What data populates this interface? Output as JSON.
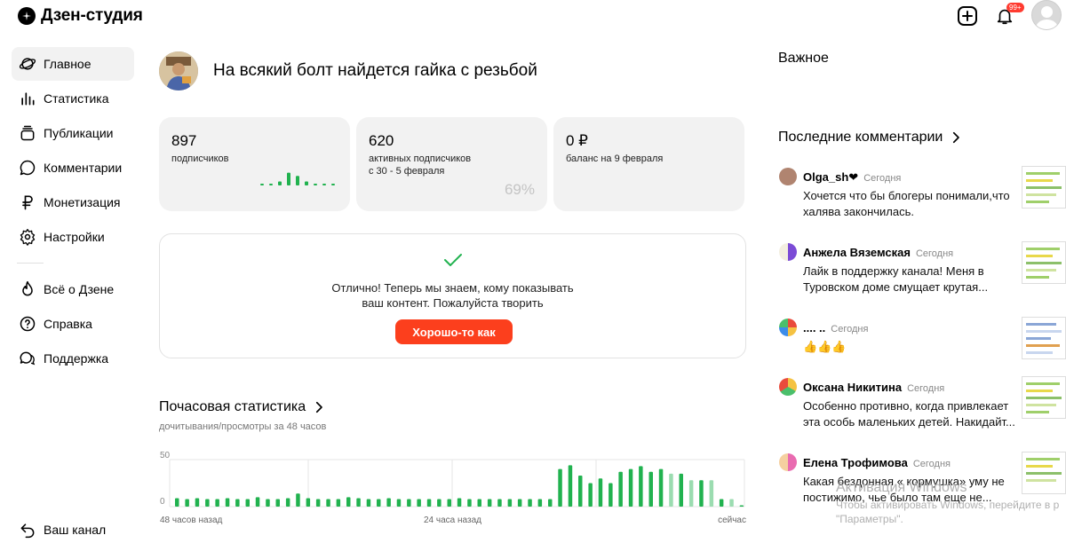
{
  "header": {
    "logo_text": "Дзен-студия",
    "notification_badge": "99+"
  },
  "sidebar": {
    "items": [
      {
        "label": "Главное",
        "icon": "planet-icon",
        "active": true
      },
      {
        "label": "Статистика",
        "icon": "bar-chart-icon"
      },
      {
        "label": "Публикации",
        "icon": "stack-icon"
      },
      {
        "label": "Комментарии",
        "icon": "comment-icon"
      },
      {
        "label": "Монетизация",
        "icon": "ruble-icon"
      },
      {
        "label": "Настройки",
        "icon": "gear-icon"
      }
    ],
    "secondary": [
      {
        "label": "Всё о Дзене",
        "icon": "flame-icon"
      },
      {
        "label": "Справка",
        "icon": "help-icon"
      },
      {
        "label": "Поддержка",
        "icon": "support-icon"
      }
    ],
    "your_channel": "Ваш канал"
  },
  "channel": {
    "title": "На всякий болт найдется гайка с резьбой"
  },
  "stats": {
    "subscribers": {
      "value": "897",
      "label": "подписчиков",
      "mini_bars": [
        0.1,
        0.1,
        0.25,
        0.8,
        0.6,
        0.25,
        0.1,
        0.1,
        0.1
      ]
    },
    "active": {
      "value": "620",
      "label": "активных подписчиков",
      "period": "с 30 - 5 февраля",
      "percent": "69%"
    },
    "balance": {
      "value": "0 ₽",
      "label": "баланс на 9 февраля"
    }
  },
  "success": {
    "line1": "Отлично! Теперь мы знаем, кому показывать",
    "line2": "ваш контент. Пожалуйста творить",
    "button": "Хорошо-то как"
  },
  "hourly": {
    "title": "Почасовая статистика",
    "subtitle": "дочитывания/просмотры за 48 часов",
    "y_max_label": "50",
    "y_min_label": "0",
    "x_labels": [
      "48 часов назад",
      "24 часа назад",
      "сейчас"
    ]
  },
  "chart_data": {
    "type": "bar",
    "title": "Почасовая статистика",
    "subtitle": "дочитывания/просмотры за 48 часов",
    "ylim": [
      0,
      50
    ],
    "x_tick_labels": [
      "48 часов назад",
      "24 часа назад",
      "сейчас"
    ],
    "series": [
      {
        "values": [
          9,
          8,
          9,
          8,
          8,
          9,
          8,
          8,
          10,
          8,
          8,
          9,
          14,
          9,
          8,
          8,
          8,
          10,
          9,
          8,
          8,
          9,
          8,
          8,
          8,
          8,
          8,
          8,
          9,
          8,
          8,
          8,
          8,
          8,
          8,
          8,
          8,
          8,
          40,
          44,
          33,
          25,
          30,
          25,
          37,
          40,
          43,
          37,
          40,
          35,
          35,
          28,
          28,
          28,
          8,
          8,
          1
        ]
      }
    ],
    "colors": {
      "bars": "#21b24f",
      "recent_bars": "#9bdcb0"
    }
  },
  "right": {
    "important": "Важное",
    "last_comments": "Последние комментарии",
    "comments": [
      {
        "author": "Olga_sh❤",
        "time": "Сегодня",
        "text": "Хочется что бы блогеры понимали,что халява закончилась."
      },
      {
        "author": "Анжела Вяземская",
        "time": "Сегодня",
        "text": "Лайк в поддержку канала! Меня в Туровском доме смущает крутая..."
      },
      {
        "author": ".... ..",
        "time": "Сегодня",
        "text": "👍👍👍"
      },
      {
        "author": "Оксана Никитина",
        "time": "Сегодня",
        "text": "Особенно противно, когда привлекает эта особь маленьких детей. Накидайт..."
      },
      {
        "author": "Елена Трофимова",
        "time": "Сегодня",
        "text": "Какая бездонная « кормушка» уму не постижимо, чье было там еще не..."
      }
    ]
  },
  "watermark": {
    "line1": "Активация Windows",
    "line2": "Чтобы активировать Windows, перейдите в р \"Параметры\"."
  },
  "colors": {
    "accent": "#fc3f1d",
    "green": "#21b24f",
    "card_bg": "#f2f2f2"
  }
}
